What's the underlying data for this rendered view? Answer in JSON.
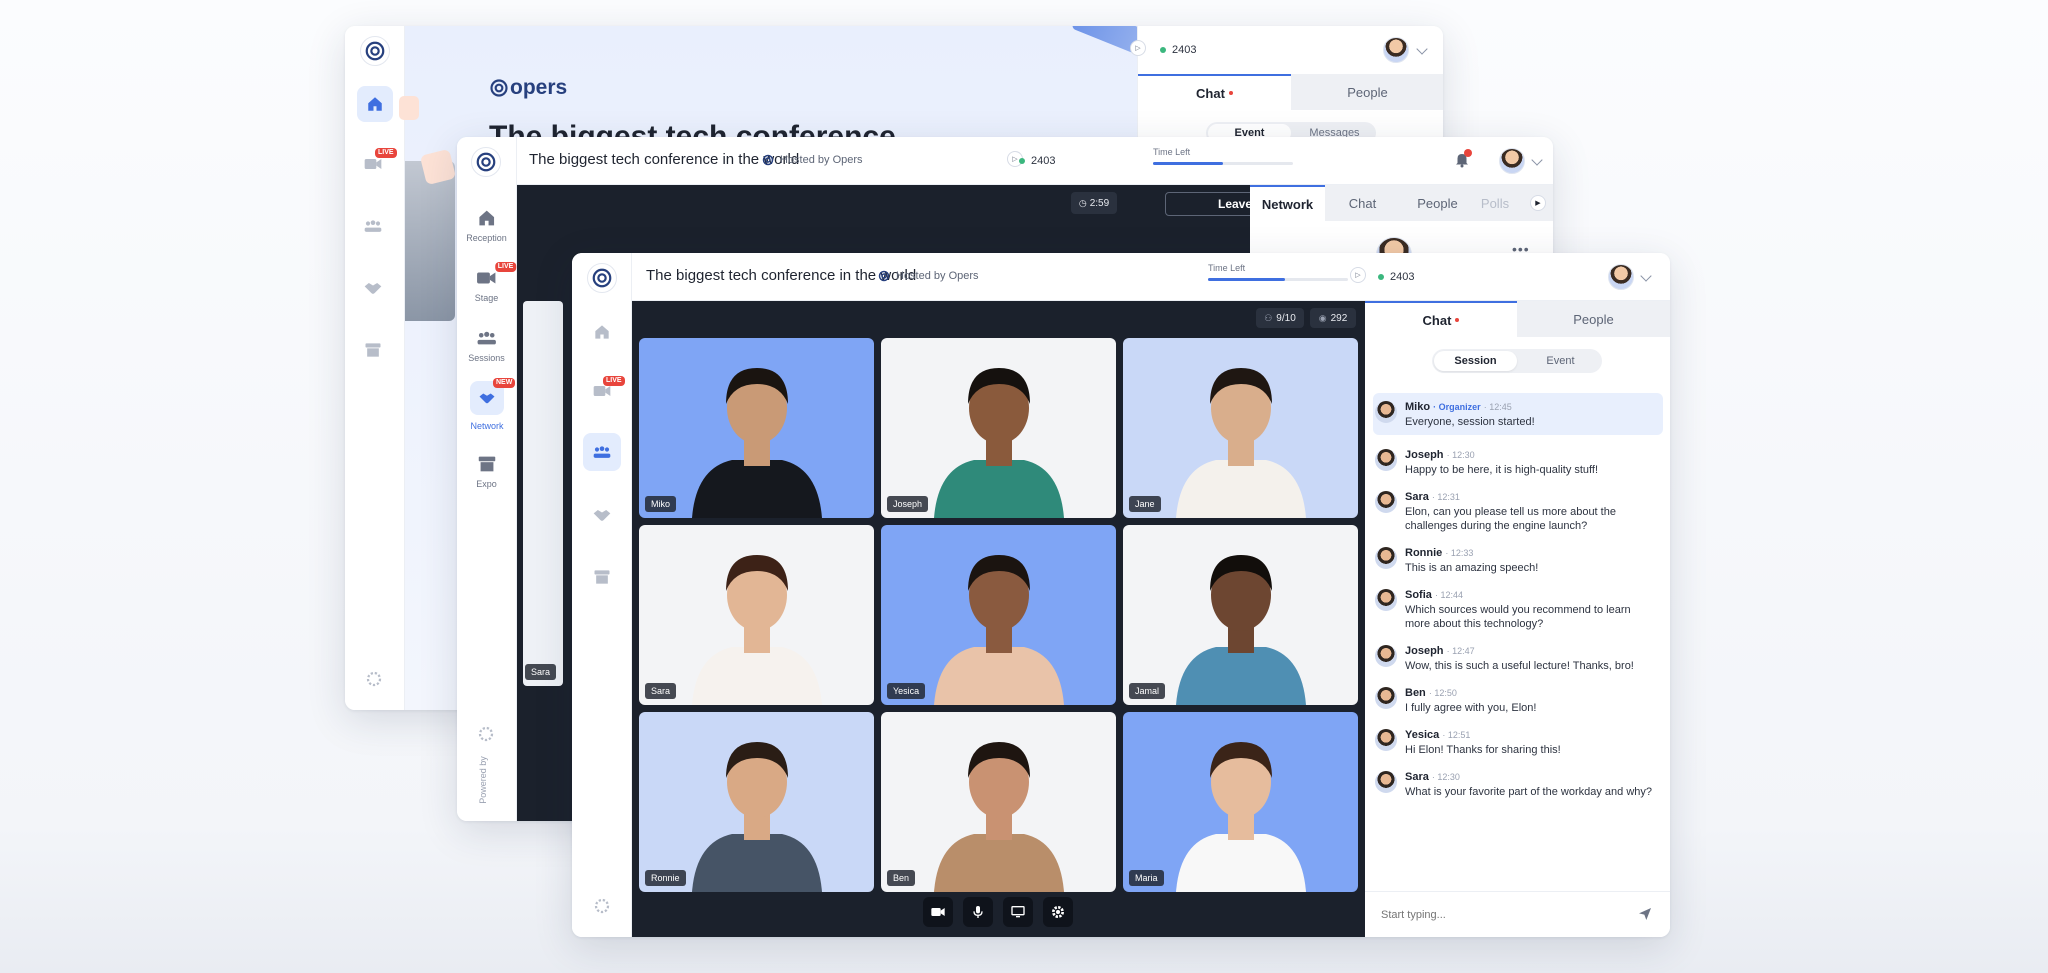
{
  "back_window": {
    "brand": "opers",
    "hero_title": "The biggest tech conference",
    "online_count": "2403",
    "tabs": [
      "Chat",
      "People"
    ],
    "subtabs": [
      "Event",
      "Messages"
    ]
  },
  "mid_window": {
    "title": "The biggest tech conference in the world",
    "hosted_by": "Hosted by Opers",
    "time_left_label": "Time Left",
    "time_progress": 0.5,
    "online_count": "2403",
    "timer": "2:59",
    "leave_label": "Leave",
    "tabs": [
      "Network",
      "Chat",
      "People",
      "Polls"
    ],
    "sidebar": {
      "reception": "Reception",
      "stage": "Stage",
      "live": "LIVE",
      "sessions": "Sessions",
      "network": "Network",
      "network_badge": "NEW",
      "expo": "Expo"
    },
    "powered_by": "Powered by",
    "tile_label": "Sara"
  },
  "front_window": {
    "title": "The biggest tech conference in the world",
    "hosted_by": "Hosted by Opers",
    "time_left_label": "Time Left",
    "time_progress": 0.55,
    "online_count": "2403",
    "participants": "9/10",
    "viewers": "292",
    "live": "LIVE",
    "tiles": [
      {
        "name": "Miko",
        "bg": "#7fa5f5",
        "shirt": "#15181e",
        "skin": "#c99a76",
        "hair": "#1a1410"
      },
      {
        "name": "Joseph",
        "bg": "#f3f4f6",
        "shirt": "#2f8a7a",
        "skin": "#8a5a3c",
        "hair": "#15110e"
      },
      {
        "name": "Jane",
        "bg": "#c9d8f7",
        "shirt": "#f4f1ec",
        "skin": "#d9ae8c",
        "hair": "#1f1712"
      },
      {
        "name": "Sara",
        "bg": "#f3f4f6",
        "shirt": "#f6f2ee",
        "skin": "#e2b695",
        "hair": "#3d2217"
      },
      {
        "name": "Yesica",
        "bg": "#7fa5f5",
        "shirt": "#e9c3a9",
        "skin": "#8a5a3f",
        "hair": "#1b1410"
      },
      {
        "name": "Jamal",
        "bg": "#f3f4f6",
        "shirt": "#4f8fb3",
        "skin": "#6d4631",
        "hair": "#120e0b"
      },
      {
        "name": "Ronnie",
        "bg": "#c9d8f7",
        "shirt": "#465466",
        "skin": "#d9a985",
        "hair": "#2a1d15"
      },
      {
        "name": "Ben",
        "bg": "#f3f4f6",
        "shirt": "#b98e6a",
        "skin": "#c99272",
        "hair": "#1e1510"
      },
      {
        "name": "Maria",
        "bg": "#7fa5f5",
        "shirt": "#f8f8f8",
        "skin": "#e6bc9d",
        "hair": "#3b2418"
      }
    ],
    "chat": {
      "tabs": [
        "Chat",
        "People"
      ],
      "subtabs": [
        "Session",
        "Event"
      ],
      "messages": [
        {
          "name": "Miko",
          "role": "Organizer",
          "time": "12:45",
          "text": "Everyone, session started!"
        },
        {
          "name": "Joseph",
          "role": "",
          "time": "12:30",
          "text": "Happy to be here, it is high-quality stuff!"
        },
        {
          "name": "Sara",
          "role": "",
          "time": "12:31",
          "text": "Elon, can you please tell us more about the challenges during the engine launch?"
        },
        {
          "name": "Ronnie",
          "role": "",
          "time": "12:33",
          "text": "This is an amazing speech!"
        },
        {
          "name": "Sofia",
          "role": "",
          "time": "12:44",
          "text": "Which sources would you recommend to learn more about this technology?"
        },
        {
          "name": "Joseph",
          "role": "",
          "time": "12:47",
          "text": "Wow, this is such a useful lecture! Thanks, bro!"
        },
        {
          "name": "Ben",
          "role": "",
          "time": "12:50",
          "text": "I fully agree with you, Elon!"
        },
        {
          "name": "Yesica",
          "role": "",
          "time": "12:51",
          "text": "Hi Elon! Thanks for sharing this!"
        },
        {
          "name": "Sara",
          "role": "",
          "time": "12:30",
          "text": "What is your favorite part of the workday and why?"
        }
      ],
      "input_placeholder": "Start typing..."
    }
  },
  "colors": {
    "accent": "#3f6fe0",
    "dark_stage": "#1b212c",
    "live_red": "#e8453c",
    "online_green": "#3bb77e"
  }
}
